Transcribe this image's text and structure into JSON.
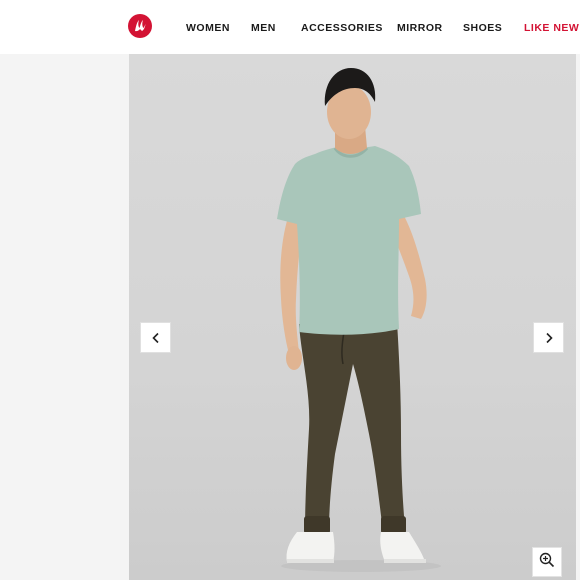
{
  "header": {
    "logo_icon": "lululemon-logo-icon",
    "brand_color": "#d31334",
    "nav": [
      {
        "label": "WOMEN"
      },
      {
        "label": "MEN"
      },
      {
        "label": "ACCESSORIES"
      },
      {
        "label": "MIRROR"
      },
      {
        "label": "SHOES"
      },
      {
        "label": "LIKE NEW"
      }
    ]
  },
  "gallery": {
    "prev_icon": "chevron-left-icon",
    "next_icon": "chevron-right-icon",
    "zoom_icon": "zoom-in-icon"
  }
}
